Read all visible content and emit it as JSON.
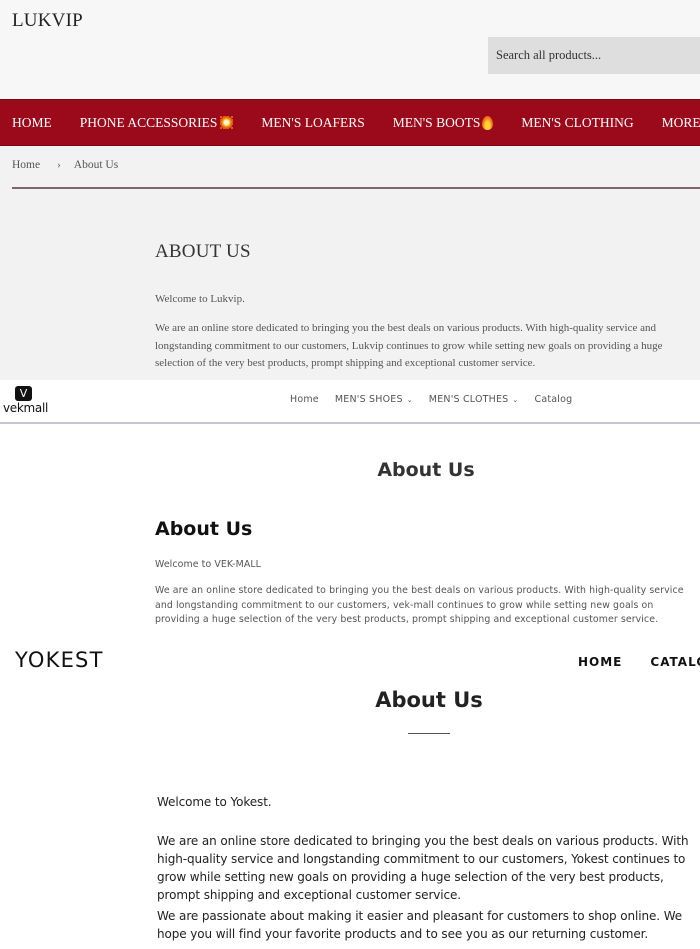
{
  "lukvip": {
    "logo": "LUKVIP",
    "search": {
      "placeholder": "Search all products..."
    },
    "nav": [
      {
        "label": "HOME",
        "icon": null
      },
      {
        "label": "PHONE ACCESSORIES",
        "icon": "sparkle-emoji-icon"
      },
      {
        "label": "MEN'S LOAFERS",
        "icon": null
      },
      {
        "label": "MEN'S BOOTS",
        "icon": "fire-emoji-icon"
      },
      {
        "label": "MEN'S CLOTHING",
        "icon": null
      },
      {
        "label": "MORE",
        "icon": null
      }
    ],
    "breadcrumb": {
      "home": "Home",
      "separator": "›",
      "current": "About Us"
    },
    "page": {
      "title": "ABOUT US",
      "welcome": "Welcome to Lukvip.",
      "paragraph": "We are an online store dedicated to bringing you the best deals on various products. With high-quality service and longstanding commitment to our customers, Lukvip continues to grow while setting new goals on providing a huge selection of the very best products, prompt shipping and exceptional customer service."
    },
    "colors": {
      "nav_bg": "#9b0a1b",
      "header_bg": "#f7f7f7",
      "body_bg": "#f2f2f2",
      "search_bg": "#dedede"
    }
  },
  "vekmall": {
    "logo": {
      "mark": "V",
      "text": "vekmall"
    },
    "nav": [
      {
        "label": "Home",
        "dropdown": false
      },
      {
        "label": "MEN'S SHOES",
        "dropdown": true
      },
      {
        "label": "MEN'S CLOTHES",
        "dropdown": true
      },
      {
        "label": "Catalog",
        "dropdown": false
      }
    ],
    "chevron": "⌄",
    "page": {
      "center_title": "About Us",
      "title": "About Us",
      "welcome": "Welcome to VEK-MALL",
      "paragraph": "We are an online store dedicated to bringing you the best deals on various products. With high-quality service and longstanding commitment to our customers, vek-mall continues to grow while setting new goals on providing a huge selection of the very best products, prompt shipping and exceptional customer service."
    }
  },
  "yokest": {
    "logo": "YOKEST",
    "nav": [
      {
        "label": "HOME"
      },
      {
        "label": "CATALOG"
      }
    ],
    "page": {
      "title": "About Us",
      "welcome": "Welcome to Yokest.",
      "paragraph1": "We are an online store dedicated to bringing you the best deals on various products. With high-quality service and longstanding commitment to our customers, Yokest continues to grow while setting new goals on providing a huge selection of the very best products, prompt shipping and exceptional customer service.",
      "paragraph2": "We are passionate about making it easier and pleasant for customers to shop online. We hope you will find your favorite products and to see you as our returning customer."
    }
  }
}
